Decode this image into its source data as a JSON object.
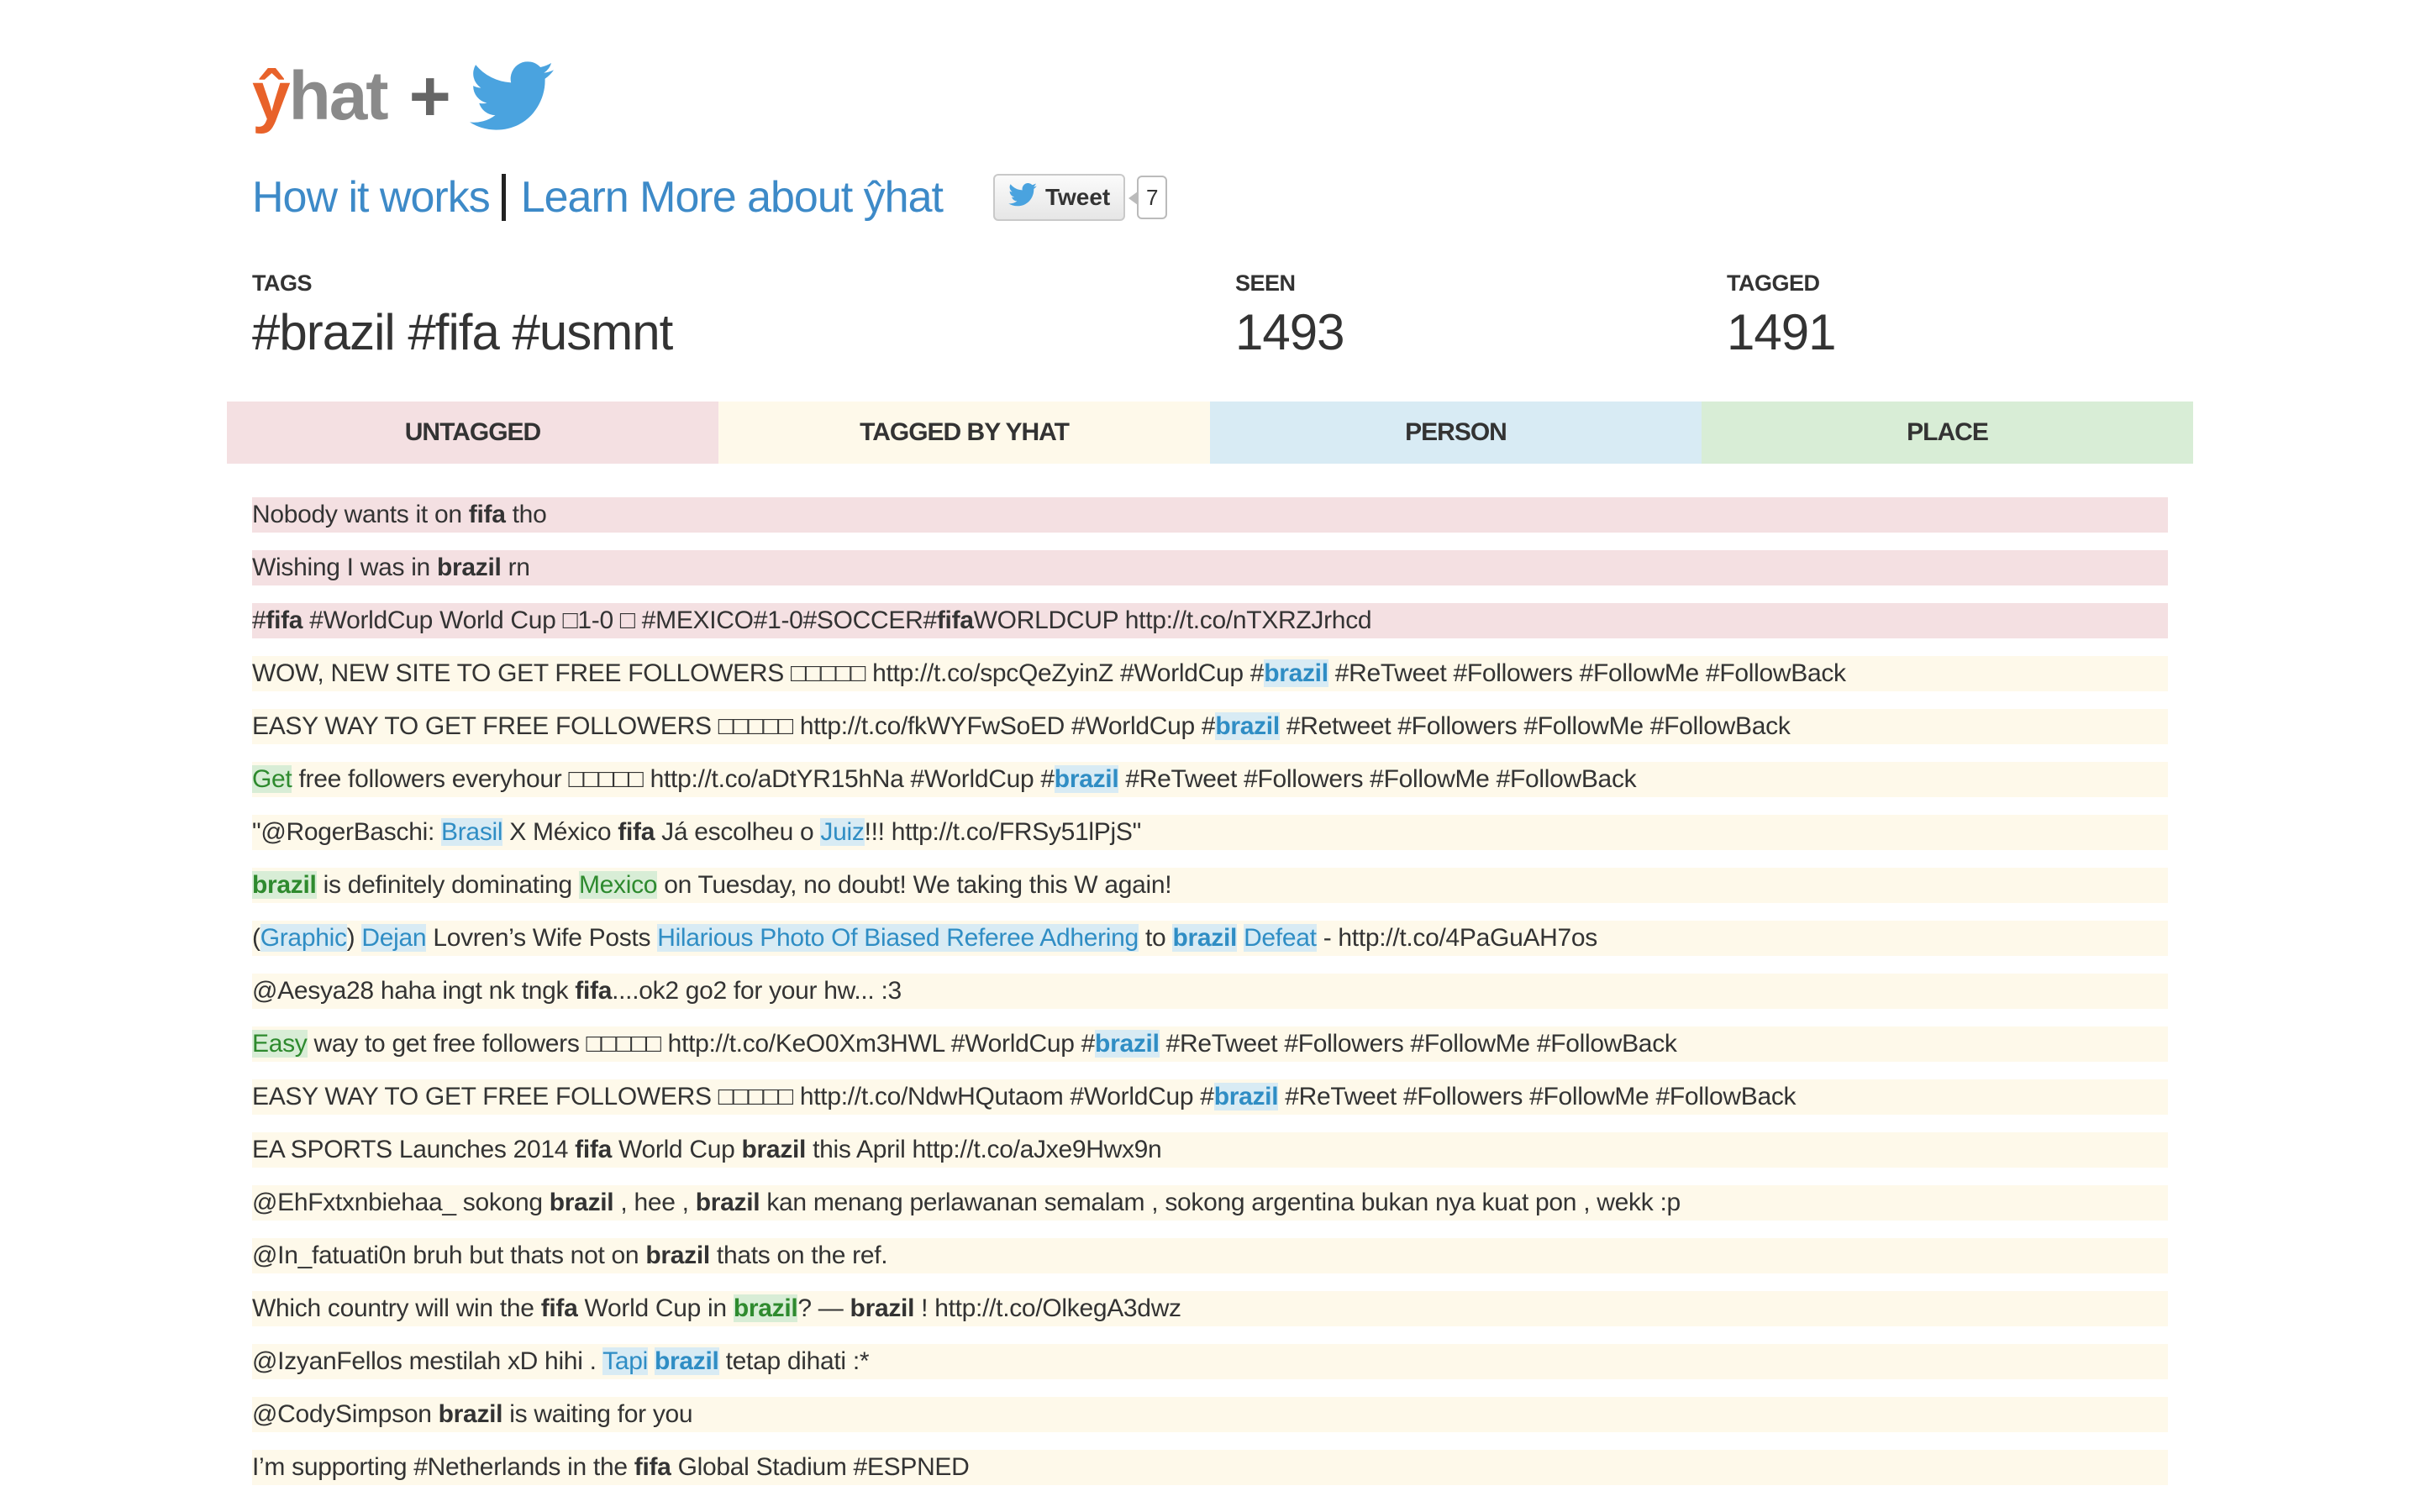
{
  "header": {
    "logo_y": "ŷ",
    "logo_rest": "hat",
    "logo_plus": "+",
    "twitter_icon": "twitter-bird-icon"
  },
  "nav": {
    "how_it_works": "How it works",
    "separator": "|",
    "learn_more": "Learn More about ŷhat",
    "tweet_label": "Tweet",
    "tweet_count": "7"
  },
  "stats": {
    "tags_label": "TAGS",
    "tags_value": "#brazil #fifa #usmnt",
    "seen_label": "SEEN",
    "seen_value": "1493",
    "tagged_label": "TAGGED",
    "tagged_value": "1491"
  },
  "legend": {
    "untagged": "UNTAGGED",
    "tagged_by_yhat": "TAGGED BY YHAT",
    "person": "PERSON",
    "place": "PLACE"
  },
  "colors": {
    "untagged": "#f4e0e2",
    "tagged_by_yhat": "#fef9ea",
    "person": "#d8ebf4",
    "place": "#d8edd6",
    "link_blue": "#3d8ac8",
    "logo_orange": "#e8622a"
  },
  "tweets": [
    {
      "type": "untagged",
      "parts": [
        {
          "t": "Nobody wants it on "
        },
        {
          "t": "fifa",
          "b": true
        },
        {
          "t": " tho"
        }
      ]
    },
    {
      "type": "untagged",
      "parts": [
        {
          "t": "Wishing I was in "
        },
        {
          "t": "brazil",
          "b": true
        },
        {
          "t": " rn"
        }
      ]
    },
    {
      "type": "untagged",
      "parts": [
        {
          "t": "#"
        },
        {
          "t": "fifa",
          "b": true
        },
        {
          "t": " #WorldCup World Cup □1-0 □ #MEXICO#1-0#SOCCER#"
        },
        {
          "t": "fifa",
          "b": true
        },
        {
          "t": "WORLDCUP http://t.co/nTXRZJrhcd"
        }
      ]
    },
    {
      "type": "tagged",
      "parts": [
        {
          "t": "WOW, NEW SITE TO GET FREE FOLLOWERS □□□□□ http://t.co/spcQeZyinZ #WorldCup #"
        },
        {
          "t": "brazil",
          "b": true,
          "h": "person"
        },
        {
          "t": " #ReTweet #Followers #FollowMe #FollowBack"
        }
      ]
    },
    {
      "type": "tagged",
      "parts": [
        {
          "t": "EASY WAY TO GET FREE FOLLOWERS □□□□□ http://t.co/fkWYFwSoED #WorldCup #"
        },
        {
          "t": "brazil",
          "b": true,
          "h": "person"
        },
        {
          "t": " #Retweet #Followers #FollowMe #FollowBack"
        }
      ]
    },
    {
      "type": "tagged",
      "parts": [
        {
          "t": "Get",
          "h": "place"
        },
        {
          "t": " free followers everyhour □□□□□ http://t.co/aDtYR15hNa #WorldCup #"
        },
        {
          "t": "brazil",
          "b": true,
          "h": "person"
        },
        {
          "t": " #ReTweet #Followers #FollowMe #FollowBack"
        }
      ]
    },
    {
      "type": "tagged",
      "parts": [
        {
          "t": "\"@RogerBaschi: "
        },
        {
          "t": "Brasil",
          "h": "person"
        },
        {
          "t": " X México "
        },
        {
          "t": "fifa",
          "b": true
        },
        {
          "t": " Já escolheu o "
        },
        {
          "t": "Juiz",
          "h": "person"
        },
        {
          "t": "!!! http://t.co/FRSy51lPjS\""
        }
      ]
    },
    {
      "type": "tagged",
      "parts": [
        {
          "t": "brazil",
          "b": true,
          "h": "place"
        },
        {
          "t": " is definitely dominating "
        },
        {
          "t": "Mexico",
          "h": "place"
        },
        {
          "t": " on Tuesday, no doubt! We taking this W again!"
        }
      ]
    },
    {
      "type": "tagged",
      "parts": [
        {
          "t": "("
        },
        {
          "t": "Graphic",
          "h": "person"
        },
        {
          "t": ") "
        },
        {
          "t": "Dejan",
          "h": "person"
        },
        {
          "t": " Lovren’s Wife Posts "
        },
        {
          "t": "Hilarious Photo Of Biased Referee Adhering",
          "h": "person"
        },
        {
          "t": " to "
        },
        {
          "t": "brazil",
          "b": true,
          "h": "person"
        },
        {
          "t": " "
        },
        {
          "t": "Defeat",
          "h": "person"
        },
        {
          "t": " - http://t.co/4PaGuAH7os"
        }
      ]
    },
    {
      "type": "tagged",
      "parts": [
        {
          "t": "@Aesya28 haha ingt nk tngk "
        },
        {
          "t": "fifa",
          "b": true
        },
        {
          "t": "....ok2 go2 for your hw... :3"
        }
      ]
    },
    {
      "type": "tagged",
      "parts": [
        {
          "t": "Easy",
          "h": "place"
        },
        {
          "t": " way to get free followers □□□□□ http://t.co/KeO0Xm3HWL #WorldCup #"
        },
        {
          "t": "brazil",
          "b": true,
          "h": "person"
        },
        {
          "t": " #ReTweet #Followers #FollowMe #FollowBack"
        }
      ]
    },
    {
      "type": "tagged",
      "parts": [
        {
          "t": "EASY WAY TO GET FREE FOLLOWERS □□□□□ http://t.co/NdwHQutaom #WorldCup #"
        },
        {
          "t": "brazil",
          "b": true,
          "h": "person"
        },
        {
          "t": " #ReTweet #Followers #FollowMe #FollowBack"
        }
      ]
    },
    {
      "type": "tagged",
      "parts": [
        {
          "t": "EA SPORTS Launches 2014 "
        },
        {
          "t": "fifa",
          "b": true
        },
        {
          "t": " World Cup "
        },
        {
          "t": "brazil",
          "b": true
        },
        {
          "t": " this April http://t.co/aJxe9Hwx9n"
        }
      ]
    },
    {
      "type": "tagged",
      "parts": [
        {
          "t": "@EhFxtxnbiehaa_ sokong "
        },
        {
          "t": "brazil",
          "b": true
        },
        {
          "t": " , hee , "
        },
        {
          "t": "brazil",
          "b": true
        },
        {
          "t": " kan menang perlawanan semalam , sokong argentina bukan nya kuat pon , wekk :p"
        }
      ]
    },
    {
      "type": "tagged",
      "parts": [
        {
          "t": "@In_fatuati0n bruh but thats not on "
        },
        {
          "t": "brazil",
          "b": true
        },
        {
          "t": " thats on the ref."
        }
      ]
    },
    {
      "type": "tagged",
      "parts": [
        {
          "t": "Which country will win the "
        },
        {
          "t": "fifa",
          "b": true
        },
        {
          "t": " World Cup in "
        },
        {
          "t": "brazil",
          "b": true,
          "h": "place"
        },
        {
          "t": "? — "
        },
        {
          "t": "brazil",
          "b": true
        },
        {
          "t": " ! http://t.co/OlkegA3dwz"
        }
      ]
    },
    {
      "type": "tagged",
      "parts": [
        {
          "t": "@IzyanFellos mestilah xD hihi . "
        },
        {
          "t": "Tapi",
          "h": "person"
        },
        {
          "t": " "
        },
        {
          "t": "brazil",
          "b": true,
          "h": "person"
        },
        {
          "t": " tetap dihati :*"
        }
      ]
    },
    {
      "type": "tagged",
      "parts": [
        {
          "t": "@CodySimpson "
        },
        {
          "t": "brazil",
          "b": true
        },
        {
          "t": " is waiting for you"
        }
      ]
    },
    {
      "type": "tagged",
      "parts": [
        {
          "t": "I’m supporting #Netherlands in the "
        },
        {
          "t": "fifa",
          "b": true
        },
        {
          "t": " Global Stadium #ESPNED"
        }
      ]
    }
  ]
}
